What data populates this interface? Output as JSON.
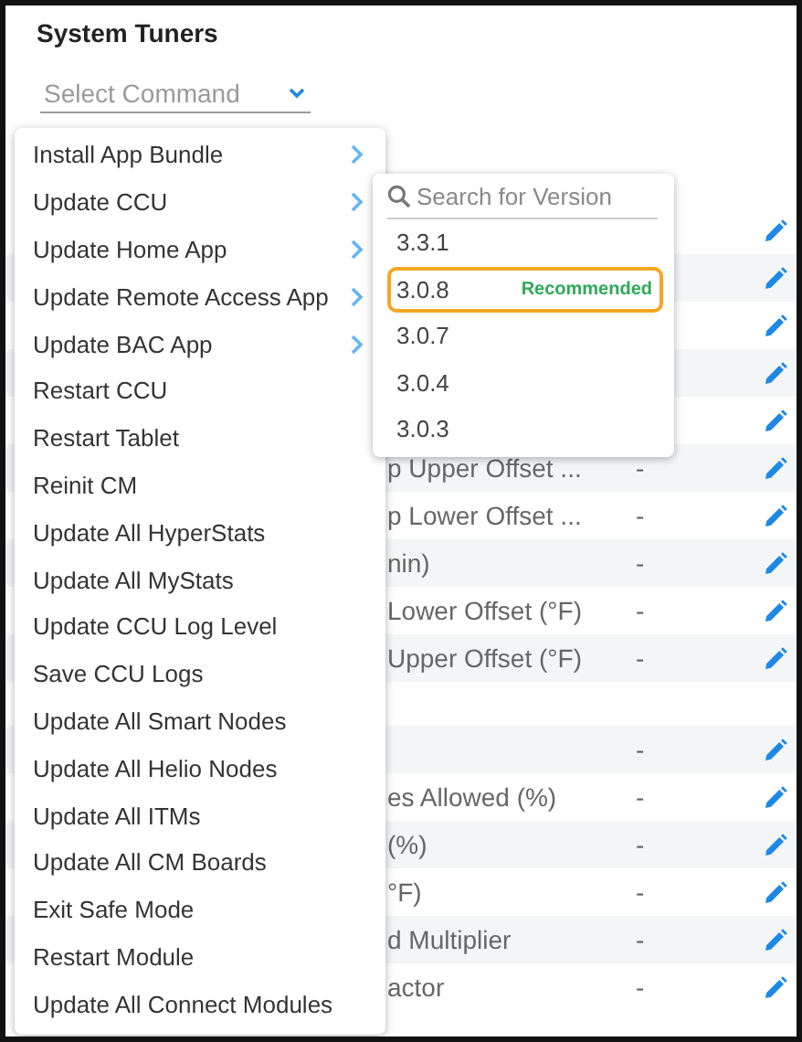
{
  "title": "System Tuners",
  "command_select": {
    "placeholder": "Select Command"
  },
  "menu": {
    "items": [
      {
        "label": "Install App Bundle",
        "has_submenu": true
      },
      {
        "label": "Update CCU",
        "has_submenu": true
      },
      {
        "label": "Update Home App",
        "has_submenu": true
      },
      {
        "label": "Update Remote Access App",
        "has_submenu": true
      },
      {
        "label": "Update BAC App",
        "has_submenu": true
      },
      {
        "label": "Restart CCU",
        "has_submenu": false
      },
      {
        "label": "Restart Tablet",
        "has_submenu": false
      },
      {
        "label": "Reinit CM",
        "has_submenu": false
      },
      {
        "label": "Update All HyperStats",
        "has_submenu": false
      },
      {
        "label": "Update All MyStats",
        "has_submenu": false
      },
      {
        "label": "Update CCU Log Level",
        "has_submenu": false
      },
      {
        "label": "Save CCU Logs",
        "has_submenu": false
      },
      {
        "label": "Update All Smart Nodes",
        "has_submenu": false
      },
      {
        "label": "Update All Helio Nodes",
        "has_submenu": false
      },
      {
        "label": "Update All ITMs",
        "has_submenu": false
      },
      {
        "label": "Update All CM Boards",
        "has_submenu": false
      },
      {
        "label": "Exit Safe Mode",
        "has_submenu": false
      },
      {
        "label": "Restart Module",
        "has_submenu": false
      },
      {
        "label": "Update All Connect Modules",
        "has_submenu": false
      }
    ]
  },
  "version_menu": {
    "search": {
      "placeholder": "Search for Version"
    },
    "versions": [
      {
        "label": "3.3.1",
        "selected": false
      },
      {
        "label": "3.0.8",
        "selected": true,
        "badge": "Recommended"
      },
      {
        "label": "3.0.7",
        "selected": false
      },
      {
        "label": "3.0.4",
        "selected": false
      },
      {
        "label": "3.0.3",
        "selected": false
      }
    ]
  },
  "table": {
    "rows": [
      {
        "kind": "row"
      },
      {
        "kind": "row"
      },
      {
        "kind": "row"
      },
      {
        "kind": "row"
      },
      {
        "kind": "row"
      },
      {
        "kind": "row",
        "name": "p Upper Offset ...",
        "value": "-"
      },
      {
        "kind": "row",
        "name": "p Lower Offset ...",
        "value": "-"
      },
      {
        "kind": "row",
        "name": "nin)",
        "value": "-"
      },
      {
        "kind": "row",
        "name": "Lower Offset (°F)",
        "value": "-"
      },
      {
        "kind": "row",
        "name": "Upper Offset (°F)",
        "value": "-"
      },
      {
        "kind": "gap"
      },
      {
        "kind": "row",
        "value": "-"
      },
      {
        "kind": "row",
        "name": "es Allowed (%)",
        "value": "-"
      },
      {
        "kind": "row",
        "name": "(%)",
        "value": "-"
      },
      {
        "kind": "row",
        "name": "°F)",
        "value": "-"
      },
      {
        "kind": "row",
        "name": "d Multiplier",
        "value": "-"
      },
      {
        "kind": "row",
        "name": "actor",
        "value": "-"
      }
    ]
  }
}
